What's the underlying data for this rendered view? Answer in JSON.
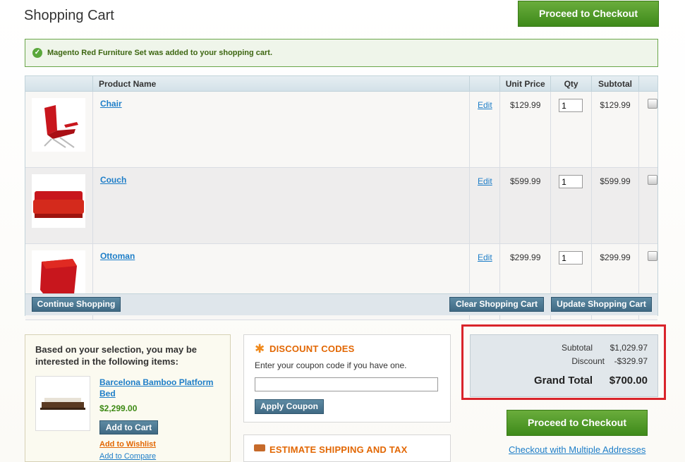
{
  "page": {
    "title": "Shopping Cart"
  },
  "buttons": {
    "checkout_top": "Proceed to Checkout",
    "checkout_bottom": "Proceed to Checkout",
    "continue": "Continue Shopping",
    "clear": "Clear Shopping Cart",
    "update": "Update Shopping Cart",
    "apply_coupon": "Apply Coupon",
    "add_to_cart": "Add to Cart"
  },
  "message": {
    "text": "Magento Red Furniture Set was added to your shopping cart."
  },
  "cart": {
    "headers": [
      "Product Name",
      "Unit Price",
      "Qty",
      "Subtotal"
    ],
    "edit_label": "Edit",
    "items": [
      {
        "name": "Chair",
        "price": "$129.99",
        "qty": "1",
        "subtotal": "$129.99"
      },
      {
        "name": "Couch",
        "price": "$599.99",
        "qty": "1",
        "subtotal": "$599.99"
      },
      {
        "name": "Ottoman",
        "price": "$299.99",
        "qty": "1",
        "subtotal": "$299.99"
      }
    ]
  },
  "crosssell": {
    "heading": "Based on your selection, you may be interested in the following items:",
    "product": "Barcelona Bamboo Platform Bed",
    "price": "$2,299.00",
    "wishlist": "Add to Wishlist",
    "compare": "Add to Compare"
  },
  "discount": {
    "title": "DISCOUNT CODES",
    "hint": "Enter your coupon code if you have one.",
    "input_value": ""
  },
  "shipping": {
    "title": "ESTIMATE SHIPPING AND TAX"
  },
  "totals": {
    "subtotal_label": "Subtotal",
    "subtotal": "$1,029.97",
    "discount_label": "Discount",
    "discount": "-$329.97",
    "grand_label": "Grand Total",
    "grand": "$700.00"
  },
  "multi_checkout": "Checkout with Multiple Addresses",
  "colors": {
    "accent_green": "#3e8a1a",
    "link": "#1e7ec8",
    "section_orange": "#e26703",
    "highlight_red": "#d9242b"
  }
}
